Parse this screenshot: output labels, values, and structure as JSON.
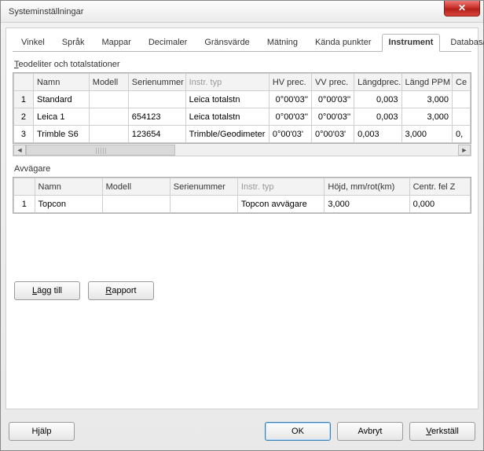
{
  "window": {
    "title": "Systeminställningar"
  },
  "tabs": [
    "Vinkel",
    "Språk",
    "Mappar",
    "Decimaler",
    "Gränsvärde",
    "Mätning",
    "Kända punkter",
    "Instrument",
    "Databas/ArcGIS"
  ],
  "active_tab": "Instrument",
  "section1": {
    "label_pre": "T",
    "label_rest": "eodeliter och totalstationer",
    "columns": [
      "Namn",
      "Modell",
      "Serienummer",
      "Instr. typ",
      "HV prec.",
      "VV prec.",
      "Längdprec.",
      "Längd PPM",
      "Ce"
    ],
    "rows": [
      {
        "idx": "1",
        "namn": "Standard",
        "modell": "",
        "serie": "",
        "typ": "Leica totalstn",
        "hv": "0°00'03''",
        "vv": "0°00'03''",
        "lp": "0,003",
        "ppm": "3,000",
        "ce": ""
      },
      {
        "idx": "2",
        "namn": "Leica 1",
        "modell": "",
        "serie": "654123",
        "typ": "Leica totalstn",
        "hv": "0°00'03''",
        "vv": "0°00'03''",
        "lp": "0,003",
        "ppm": "3,000",
        "ce": ""
      },
      {
        "idx": "3",
        "namn": "Trimble S6",
        "modell": "",
        "serie": "123654",
        "typ": "Trimble/Geodimeter",
        "hv": "0°00'03'",
        "vv": "0°00'03'",
        "lp": "0,003",
        "ppm": "3,000",
        "ce": "0,"
      }
    ],
    "selected_row": 3
  },
  "section2": {
    "label": "Avvägare",
    "columns": [
      "Namn",
      "Modell",
      "Serienummer",
      "Instr. typ",
      "Höjd, mm/rot(km)",
      "Centr. fel Z"
    ],
    "rows": [
      {
        "idx": "1",
        "namn": "Topcon",
        "modell": "",
        "serie": "",
        "typ": "Topcon avvägare",
        "hojd": "3,000",
        "cfz": "0,000"
      }
    ],
    "selected_row": 1
  },
  "buttons": {
    "add": "Lägg till",
    "report": "Rapport",
    "help": "Hjälp",
    "ok": "OK",
    "cancel": "Avbryt",
    "apply": "Verkställ"
  }
}
